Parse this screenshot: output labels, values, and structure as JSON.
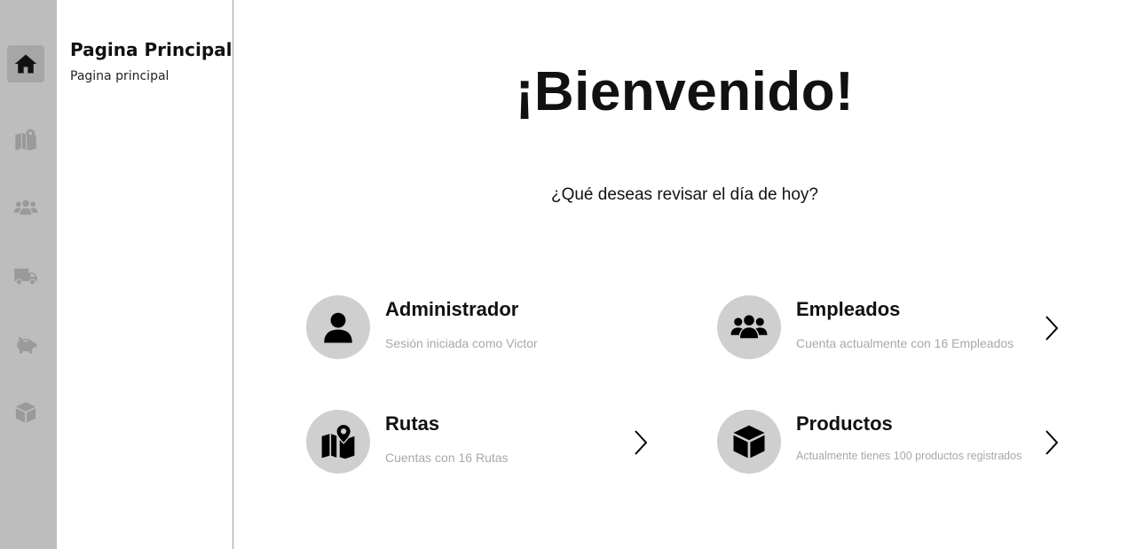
{
  "sidebar_rail": {
    "items": [
      {
        "icon": "home-icon",
        "active": true
      },
      {
        "icon": "map-icon",
        "active": false
      },
      {
        "icon": "users-icon",
        "active": false
      },
      {
        "icon": "truck-icon",
        "active": false
      },
      {
        "icon": "piggy-bank-icon",
        "active": false
      },
      {
        "icon": "box-icon",
        "active": false
      }
    ],
    "colors": {
      "background": "#bdbdbd",
      "active": "#a6a6a6",
      "icon": "#9a9a9a",
      "icon_active": "#111111"
    }
  },
  "panel": {
    "title": "Pagina Principal",
    "subtitle": "Pagina principal"
  },
  "main": {
    "welcome": "¡Bienvenido!",
    "question": "¿Qué deseas revisar el día de hoy?",
    "cards": [
      {
        "title": "Administrador",
        "subtitle": "Sesión iniciada como Victor",
        "icon": "user-icon",
        "has_chevron": false
      },
      {
        "title": "Empleados",
        "subtitle": "Cuenta actualmente con 16 Empleados",
        "icon": "users-icon",
        "has_chevron": true
      },
      {
        "title": "Rutas",
        "subtitle": "Cuentas con 16 Rutas",
        "icon": "map-pin-icon",
        "has_chevron": true
      },
      {
        "title": "Productos",
        "subtitle": "Actualmente tienes 100 productos registrados",
        "icon": "box-icon",
        "has_chevron": true
      }
    ]
  }
}
